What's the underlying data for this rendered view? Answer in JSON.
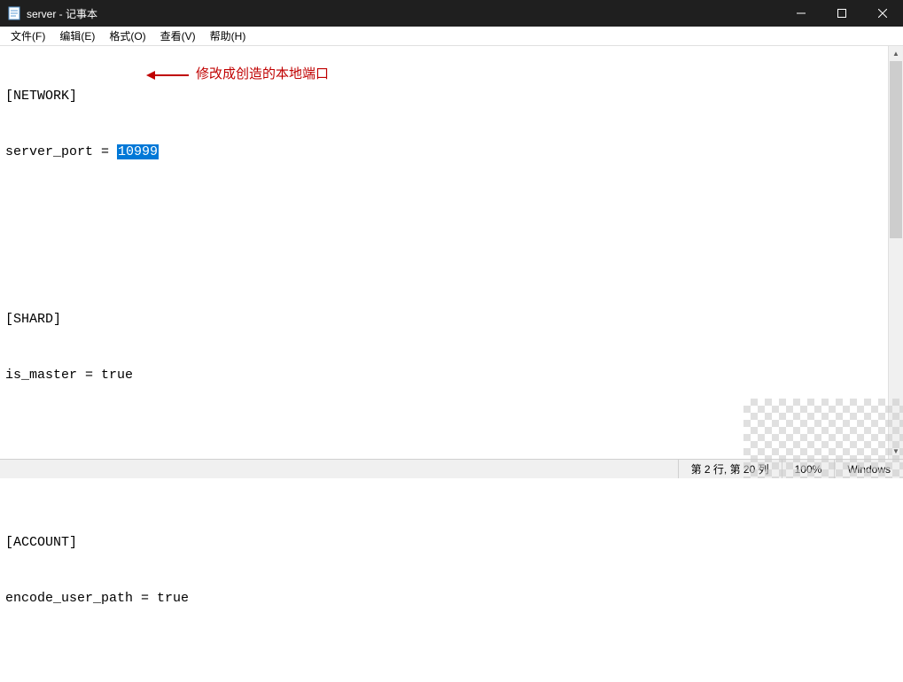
{
  "window": {
    "title": "server - 记事本"
  },
  "menu": {
    "file": "文件(F)",
    "edit": "编辑(E)",
    "format": "格式(O)",
    "view": "查看(V)",
    "help": "帮助(H)"
  },
  "editor": {
    "section_network": "[NETWORK]",
    "server_port_label": "server_port = ",
    "server_port_value": "10999",
    "section_shard": "[SHARD]",
    "is_master_line": "is_master = true",
    "section_account": "[ACCOUNT]",
    "encode_user_path_line": "encode_user_path = true"
  },
  "annotation": {
    "text": "修改成创造的本地端口"
  },
  "status": {
    "position": "第 2 行, 第 20 列",
    "zoom": "100%",
    "line_ending": "Windows"
  }
}
